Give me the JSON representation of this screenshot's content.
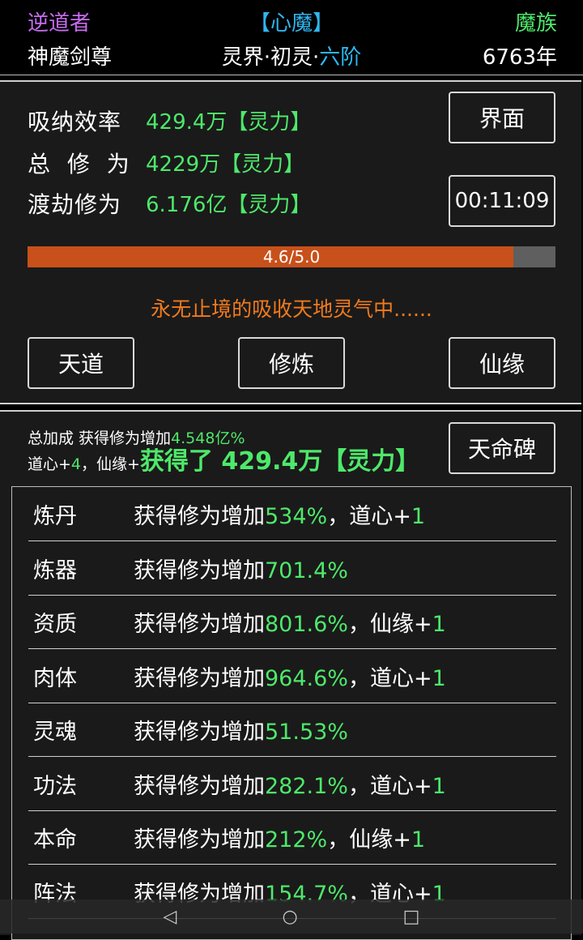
{
  "header": {
    "role": "逆道者",
    "state": "【心魔】",
    "race": "魔族",
    "name": "神魔剑尊",
    "realm_prefix": "灵界·初灵·",
    "realm_stage": "六阶",
    "age": "6763年"
  },
  "stats": {
    "rate_label": "吸纳效率",
    "rate_value": "429.4万【灵力】",
    "total_label": "总 修 为",
    "total_value": "4229万【灵力】",
    "tribulation_label": "渡劫修为",
    "tribulation_value": "6.176亿【灵力】",
    "interface_btn": "界面",
    "timer": "00:11:09"
  },
  "progress": {
    "text": "4.6/5.0",
    "value": 0.92
  },
  "status_message": "永无止境的吸收天地灵气中......",
  "actions": {
    "tiandao": "天道",
    "xiulian": "修炼",
    "xianyuan": "仙缘"
  },
  "bonus": {
    "prefix": "总加成 获得修为增加",
    "percent": "4.548亿%",
    "daoxin_label": "道心+",
    "daoxin_value": "4",
    "xianyuan_label": "，仙缘+",
    "gain_text": "获得了 429.4万【灵力】",
    "tianmingbei_btn": "天命碑"
  },
  "items": [
    {
      "name": "炼丹",
      "desc": "获得修为增加",
      "pct": "534%",
      "extra": "，道心+",
      "extra_val": "1"
    },
    {
      "name": "炼器",
      "desc": "获得修为增加",
      "pct": "701.4%",
      "extra": "",
      "extra_val": ""
    },
    {
      "name": "资质",
      "desc": "获得修为增加",
      "pct": "801.6%",
      "extra": "，仙缘+",
      "extra_val": "1"
    },
    {
      "name": "肉体",
      "desc": "获得修为增加",
      "pct": "964.6%",
      "extra": "，道心+",
      "extra_val": "1"
    },
    {
      "name": "灵魂",
      "desc": "获得修为增加",
      "pct": "51.53%",
      "extra": "",
      "extra_val": ""
    },
    {
      "name": "功法",
      "desc": "获得修为增加",
      "pct": "282.1%",
      "extra": "，道心+",
      "extra_val": "1"
    },
    {
      "name": "本命",
      "desc": "获得修为增加",
      "pct": "212%",
      "extra": "，仙缘+",
      "extra_val": "1"
    },
    {
      "name": "阵法",
      "desc": "获得修为增加",
      "pct": "154.7%",
      "extra": "，道心+",
      "extra_val": "1"
    }
  ],
  "navbar": {
    "back_icon": "◁",
    "home_icon": "○",
    "recent_icon": "□"
  }
}
